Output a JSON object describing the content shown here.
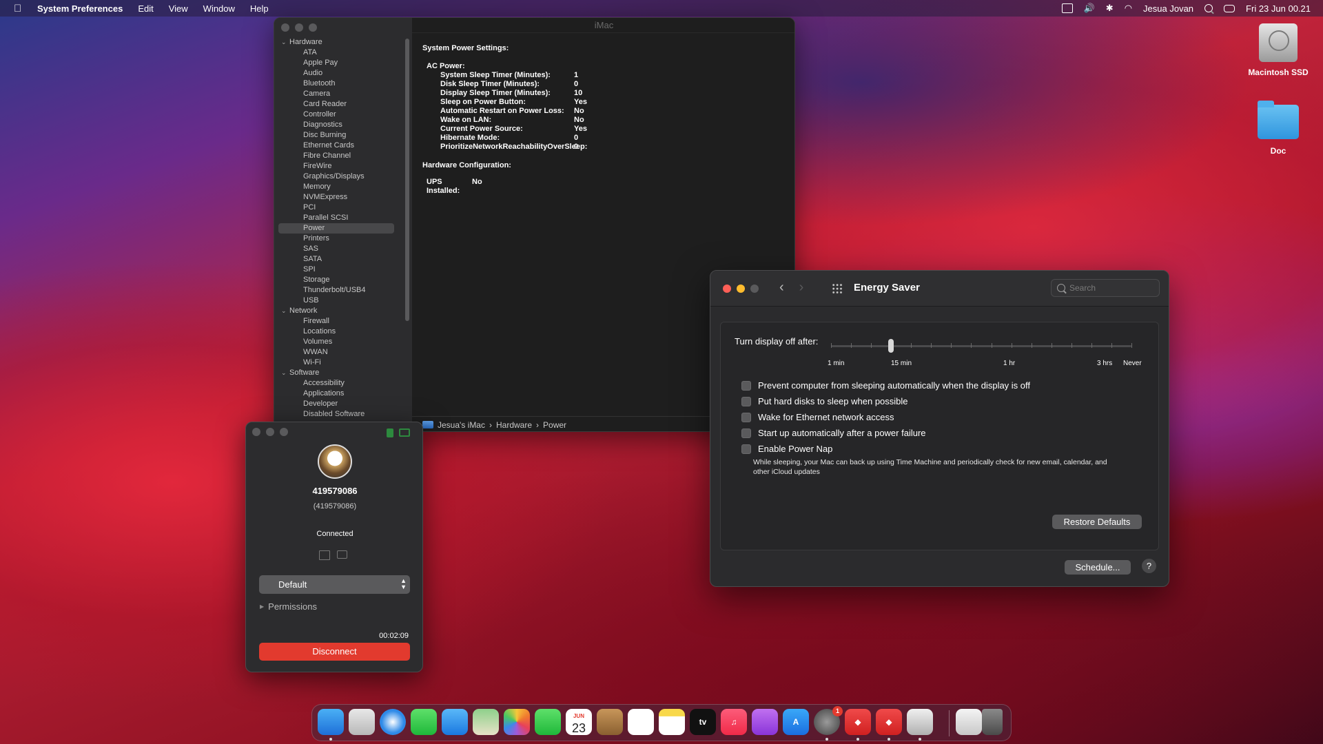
{
  "menubar": {
    "apple": "",
    "app_name": "System Preferences",
    "menus": [
      "Edit",
      "View",
      "Window",
      "Help"
    ],
    "user": "Jesua Jovan",
    "datetime": "Fri 23 Jun  00.21"
  },
  "desktop": {
    "icons": [
      {
        "label": "Macintosh SSD",
        "icon": "hard-drive-icon"
      },
      {
        "label": "Doc",
        "icon": "folder-icon"
      }
    ]
  },
  "sysinfo": {
    "title": "iMac",
    "sidebar": {
      "groups": [
        {
          "label": "Hardware",
          "items": [
            "ATA",
            "Apple Pay",
            "Audio",
            "Bluetooth",
            "Camera",
            "Card Reader",
            "Controller",
            "Diagnostics",
            "Disc Burning",
            "Ethernet Cards",
            "Fibre Channel",
            "FireWire",
            "Graphics/Displays",
            "Memory",
            "NVMExpress",
            "PCI",
            "Parallel SCSI",
            "Power",
            "Printers",
            "SAS",
            "SATA",
            "SPI",
            "Storage",
            "Thunderbolt/USB4",
            "USB"
          ]
        },
        {
          "label": "Network",
          "items": [
            "Firewall",
            "Locations",
            "Volumes",
            "WWAN",
            "Wi-Fi"
          ]
        },
        {
          "label": "Software",
          "items": [
            "Accessibility",
            "Applications",
            "Developer",
            "Disabled Software"
          ]
        }
      ],
      "selected": "Power"
    },
    "content": {
      "heading1": "System Power Settings:",
      "ac_power_label": "AC Power:",
      "ac_power": [
        {
          "k": "System Sleep Timer (Minutes):",
          "v": "1"
        },
        {
          "k": "Disk Sleep Timer (Minutes):",
          "v": "0"
        },
        {
          "k": "Display Sleep Timer (Minutes):",
          "v": "10"
        },
        {
          "k": "Sleep on Power Button:",
          "v": "Yes"
        },
        {
          "k": "Automatic Restart on Power Loss:",
          "v": "No"
        },
        {
          "k": "Wake on LAN:",
          "v": "No"
        },
        {
          "k": "Current Power Source:",
          "v": "Yes"
        },
        {
          "k": "Hibernate Mode:",
          "v": "0"
        },
        {
          "k": "PrioritizeNetworkReachabilityOverSleep:",
          "v": "0"
        }
      ],
      "heading2": "Hardware Configuration:",
      "ups_label": "UPS Installed:",
      "ups_value": "No"
    },
    "path": [
      "Jesua's iMac",
      "Hardware",
      "Power"
    ]
  },
  "energy": {
    "title": "Energy Saver",
    "search_placeholder": "Search",
    "slider_label": "Turn display off after:",
    "slider_labels": [
      "1 min",
      "15 min",
      "1 hr",
      "3 hrs",
      "Never"
    ],
    "slider_position": 0.2,
    "checkboxes": [
      {
        "label": "Prevent computer from sleeping automatically when the display is off",
        "checked": false
      },
      {
        "label": "Put hard disks to sleep when possible",
        "checked": false
      },
      {
        "label": "Wake for Ethernet network access",
        "checked": false
      },
      {
        "label": "Start up automatically after a power failure",
        "checked": false
      },
      {
        "label": "Enable Power Nap",
        "checked": false
      }
    ],
    "power_nap_note": "While sleeping, your Mac can back up using Time Machine and periodically check for new email, calendar, and other iCloud updates",
    "restore_button": "Restore Defaults",
    "schedule_button": "Schedule...",
    "help": "?"
  },
  "remote": {
    "name": "419579086",
    "id": "(419579086)",
    "status": "Connected",
    "profile": "Default",
    "permissions": "Permissions",
    "timer": "00:02:09",
    "disconnect": "Disconnect"
  },
  "dock": {
    "calendar_month": "JUN",
    "calendar_day": "23",
    "tv_label": "tv",
    "badge": "1"
  }
}
